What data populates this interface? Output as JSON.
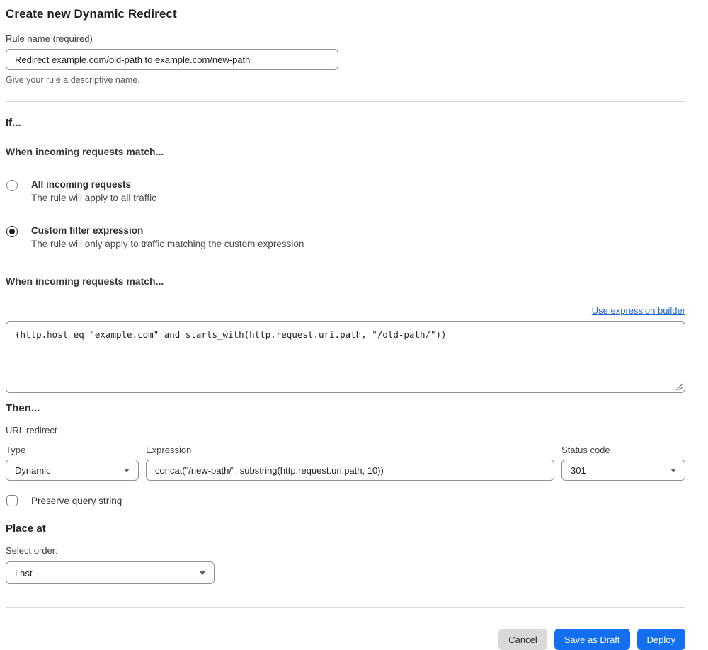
{
  "page": {
    "title": "Create new Dynamic Redirect"
  },
  "rule_name": {
    "label": "Rule name (required)",
    "value": "Redirect example.com/old-path to example.com/new-path",
    "help": "Give your rule a descriptive name."
  },
  "if_section": {
    "heading": "If...",
    "subheading": "When incoming requests match...",
    "options": [
      {
        "label": "All incoming requests",
        "description": "The rule will apply to all traffic",
        "selected": false
      },
      {
        "label": "Custom filter expression",
        "description": "The rule will only apply to traffic matching the custom expression",
        "selected": true
      }
    ]
  },
  "expression_editor": {
    "heading": "When incoming requests match...",
    "builder_link": "Use expression builder",
    "value": "(http.host eq \"example.com\" and starts_with(http.request.uri.path, \"/old-path/\"))"
  },
  "then_section": {
    "heading": "Then...",
    "subheading": "URL redirect",
    "type_field": {
      "label": "Type",
      "value": "Dynamic"
    },
    "expression_field": {
      "label": "Expression",
      "value": "concat(\"/new-path/\", substring(http.request.uri.path, 10))"
    },
    "status_field": {
      "label": "Status code",
      "value": "301"
    },
    "preserve_query": {
      "label": "Preserve query string",
      "checked": false
    }
  },
  "place_at": {
    "heading": "Place at",
    "label": "Select order:",
    "value": "Last"
  },
  "footer": {
    "cancel_label": "Cancel",
    "save_draft_label": "Save as Draft",
    "deploy_label": "Deploy"
  },
  "colors": {
    "primary_button": "#146ef0",
    "link": "#2264cb",
    "border": "#8f9297",
    "divider": "#d7d7d9",
    "cancel_button": "#d9d9da"
  }
}
